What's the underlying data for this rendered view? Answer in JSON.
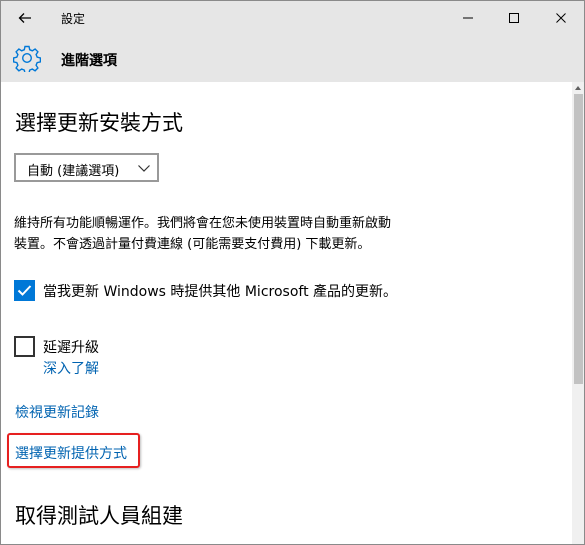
{
  "titlebar": {
    "title": "設定",
    "back_icon": "arrow-left-icon",
    "minimize_icon": "minimize-icon",
    "maximize_icon": "maximize-icon",
    "close_icon": "close-icon"
  },
  "header": {
    "icon": "gear-icon",
    "title": "進階選項"
  },
  "main": {
    "install_heading": "選擇更新安裝方式",
    "install_mode": {
      "selected": "自動 (建議選項)"
    },
    "description_line1": "維持所有功能順暢運作。我們將會在您未使用裝置時自動重新啟動",
    "description_line2": "裝置。不會透過計量付費連線 (可能需要支付費用) 下載更新。",
    "option_other_products": {
      "label": "當我更新 Windows 時提供其他 Microsoft 產品的更新。",
      "checked": true
    },
    "option_defer": {
      "label": "延遲升級",
      "checked": false
    },
    "learn_more_link": "深入了解",
    "view_history_link": "檢視更新記錄",
    "delivery_link": "選擇更新提供方式",
    "insider_heading": "取得測試人員組建"
  },
  "colors": {
    "accent": "#0078d7",
    "link": "#0063b1",
    "highlight": "#e62020",
    "chrome": "#e6e6e6"
  }
}
